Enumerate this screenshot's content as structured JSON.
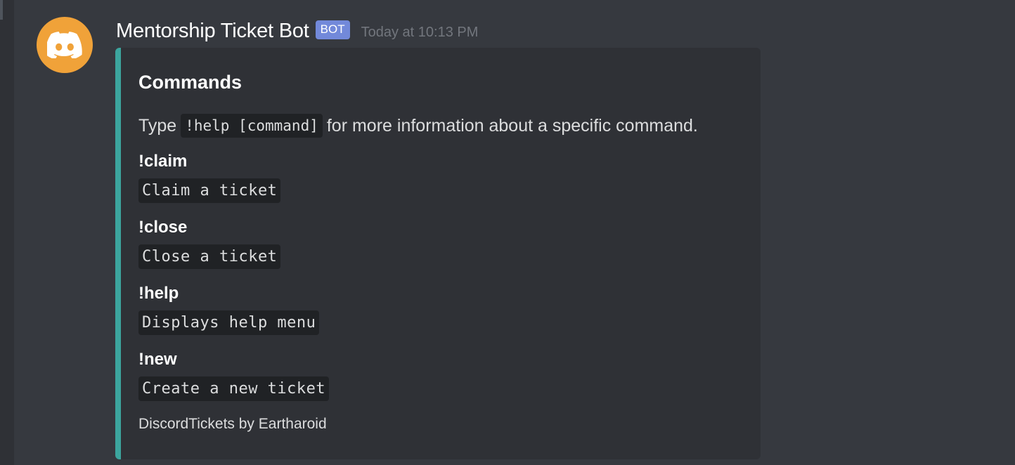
{
  "message": {
    "author": "Mentorship Ticket Bot",
    "bot_tag": "BOT",
    "timestamp": "Today at 10:13 PM",
    "avatar_icon": "discord-logo-icon",
    "avatar_color": "#f0a239"
  },
  "embed": {
    "accent_color": "#3ca59e",
    "title": "Commands",
    "description": {
      "prefix": "Type",
      "code": "!help [command]",
      "suffix": "for more information about a specific command."
    },
    "fields": [
      {
        "name": "!claim",
        "value": "Claim a ticket"
      },
      {
        "name": "!close",
        "value": "Close a ticket"
      },
      {
        "name": "!help",
        "value": "Displays help menu"
      },
      {
        "name": "!new",
        "value": "Create a new ticket"
      }
    ],
    "footer": "DiscordTickets by Eartharoid"
  }
}
